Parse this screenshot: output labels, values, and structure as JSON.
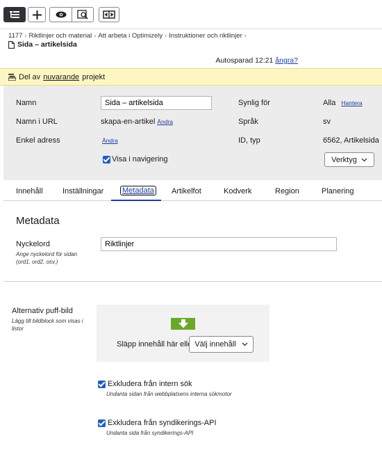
{
  "toolbar": {
    "buttons": [
      "tree-icon",
      "plus-icon",
      "eye-icon",
      "preview-icon",
      "compare-icon"
    ]
  },
  "breadcrumb": {
    "items": [
      "1177",
      "Riktlinjer och material",
      "Att arbeta i Optimizely",
      "Instruktioner och riktlinjer"
    ]
  },
  "page": {
    "title": "Sida – artikelsida"
  },
  "autosave": {
    "text": "Autosparad 12:21",
    "undo": "ångra?"
  },
  "project_bar": {
    "prefix": "Del av",
    "link": "nuvarande",
    "suffix": "projekt"
  },
  "props": {
    "name_label": "Namn",
    "name_value": "Sida – artikelsida",
    "url_label": "Namn i URL",
    "url_value": "skapa-en-artikel",
    "url_change": "Ändra",
    "simple_label": "Enkel adress",
    "simple_change": "Ändra",
    "visible_label": "Synlig för",
    "visible_value": "Alla",
    "visible_manage": "Hantera",
    "lang_label": "Språk",
    "lang_value": "sv",
    "id_label": "ID, typ",
    "id_value": "6562, Artikelsida",
    "nav_checkbox": "Visa i navigering",
    "tools_button": "Verktyg"
  },
  "tabs": [
    {
      "label": "Innehåll"
    },
    {
      "label": "Inställningar"
    },
    {
      "label": "Metadata"
    },
    {
      "label": "Artikelfot"
    },
    {
      "label": "Kodverk"
    },
    {
      "label": "Region"
    },
    {
      "label": "Planering"
    }
  ],
  "content": {
    "section_title": "Metadata",
    "keyword_label": "Nyckelord",
    "keyword_help": "Ange nyckelord för sidan (ord1, ord2, osv.)",
    "keyword_value": "Riktlinjer",
    "puff_label": "Alternativ puff-bild",
    "puff_help": "Lägg till bildblock som visas i listor",
    "drop_text": "Släpp innehåll här eller",
    "choose_button": "Välj innehåll",
    "exclude_search": "Exkludera från intern sök",
    "exclude_search_help": "Undanta sidan från webbplatsens interna sökmotor",
    "exclude_api": "Exkludera från syndikerings-API",
    "exclude_api_help": "Undanta sida från syndikerings-API"
  },
  "colors": {
    "accent": "#1e3c9a",
    "project_bar": "#fdf6c3",
    "drop_arrow": "#6aa82a",
    "checkbox": "#1f5fbf"
  }
}
